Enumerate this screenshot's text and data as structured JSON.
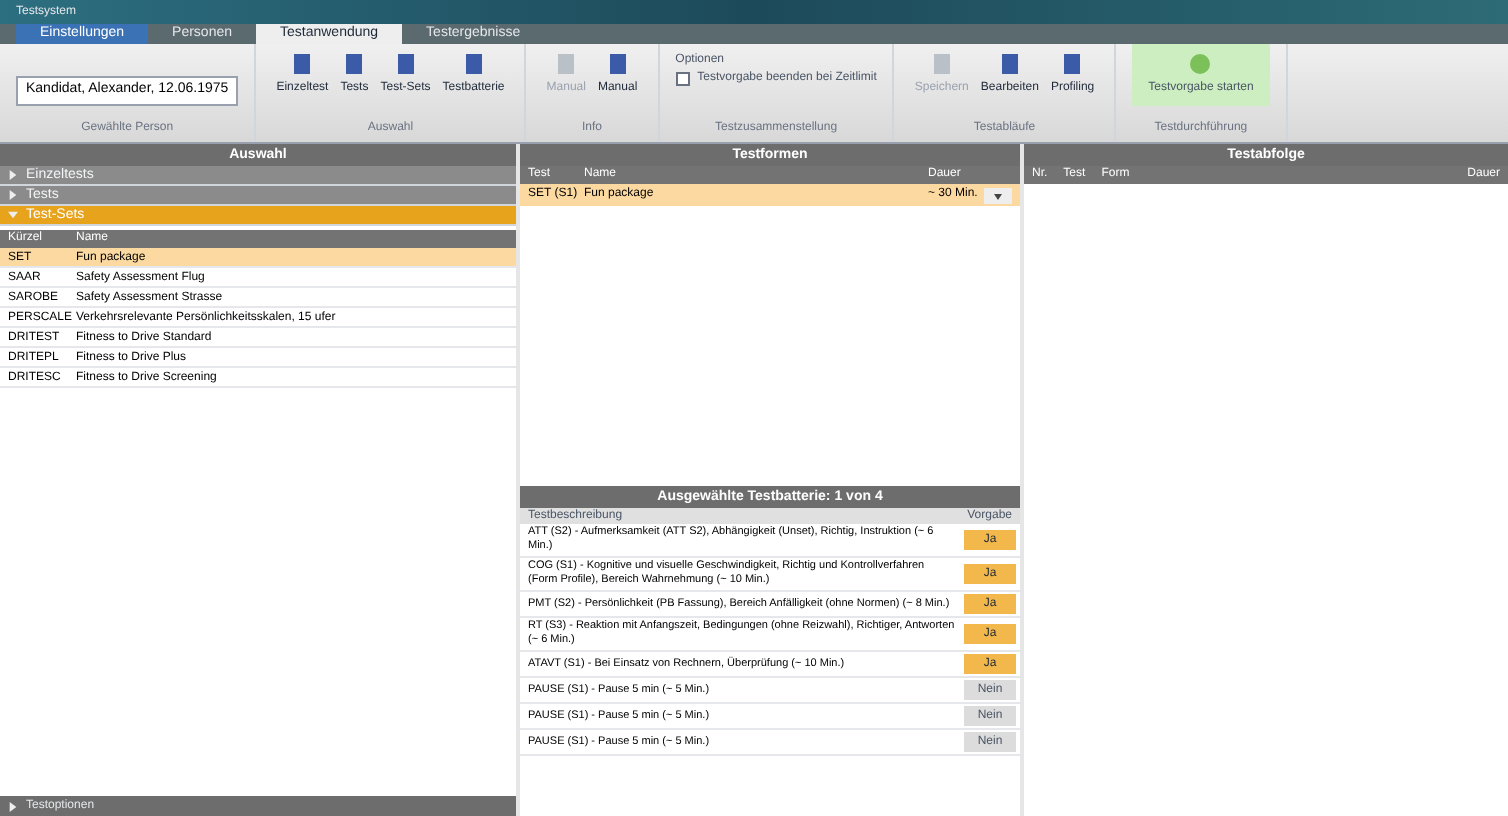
{
  "window": {
    "title": "Testsystem"
  },
  "tabs": [
    {
      "label": "Einstellungen",
      "selected": false
    },
    {
      "label": "Personen",
      "selected": false
    },
    {
      "label": "Testanwendung",
      "selected": true
    },
    {
      "label": "Testergebnisse",
      "selected": false
    }
  ],
  "ribbon": {
    "groups": [
      {
        "kind": "field",
        "caption": "Gewählte Person",
        "value": "Kandidat, Alexander, 12.06.1975"
      },
      {
        "kind": "buttons",
        "caption": "Auswahl",
        "buttons": [
          {
            "label": "Einzeltest",
            "disabled": false
          },
          {
            "label": "Tests",
            "disabled": false
          },
          {
            "label": "Test-Sets",
            "disabled": false
          },
          {
            "label": "Testbatterie",
            "disabled": false
          }
        ]
      },
      {
        "kind": "buttons",
        "caption": "Info",
        "buttons": [
          {
            "label": "Manual",
            "disabled": true
          },
          {
            "label": "Manual",
            "disabled": false
          }
        ]
      },
      {
        "kind": "checkbox",
        "caption": "Testzusammenstellung",
        "heading": "Optionen",
        "label": "Testvorgabe beenden bei Zeitlimit",
        "checked": false
      },
      {
        "kind": "buttons",
        "caption": "Testabläufe",
        "buttons": [
          {
            "label": "Speichern",
            "disabled": true
          },
          {
            "label": "Bearbeiten",
            "disabled": false
          },
          {
            "label": "Profiling",
            "disabled": false
          }
        ]
      },
      {
        "kind": "start",
        "caption": "Testdurchführung",
        "label": "Testvorgabe starten"
      }
    ]
  },
  "left": {
    "title": "Auswahl",
    "sections": [
      {
        "label": "Einzeltests",
        "expanded": false
      },
      {
        "label": "Tests",
        "expanded": false
      },
      {
        "label": "Test-Sets",
        "expanded": true
      }
    ],
    "columns": [
      "Kürzel",
      "Name"
    ],
    "rows": [
      {
        "code": "SET",
        "name": "Fun package",
        "selected": true
      },
      {
        "code": "SAAR",
        "name": "Safety Assessment Flug",
        "selected": false
      },
      {
        "code": "SAROBE",
        "name": "Safety Assessment Strasse",
        "selected": false
      },
      {
        "code": "PERSCALE",
        "name": "Verkehrsrelevante Persönlichkeitsskalen, 15 ufer",
        "selected": false
      },
      {
        "code": "DRITEST",
        "name": "Fitness to Drive Standard",
        "selected": false
      },
      {
        "code": "DRITEPL",
        "name": "Fitness to Drive Plus",
        "selected": false
      },
      {
        "code": "DRITESC",
        "name": "Fitness to Drive Screening",
        "selected": false
      }
    ],
    "footer": "Testoptionen"
  },
  "middle": {
    "title": "Testformen",
    "columns": [
      "Test",
      "Name",
      "Dauer"
    ],
    "rows": [
      {
        "code": "SET (S1)",
        "name": "Fun package",
        "duration": "~ 30 Min.",
        "selected": true
      }
    ],
    "battery": {
      "title": "Ausgewählte Testbatterie: 1 von 4",
      "columns": [
        "Testbeschreibung",
        "Vorgabe"
      ],
      "rows": [
        {
          "text": "ATT (S2) - Aufmerksamkeit (ATT S2), Abhängigkeit (Unset), Richtig, Instruktion (~ 6 Min.)",
          "vorgabe": "Ja",
          "on": true
        },
        {
          "text": "COG (S1) - Kognitive und visuelle Geschwindigkeit, Richtig und Kontrollverfahren (Form Profile), Bereich Wahrnehmung (~ 10 Min.)",
          "vorgabe": "Ja",
          "on": true
        },
        {
          "text": "PMT (S2) - Persönlichkeit (PB Fassung), Bereich Anfälligkeit (ohne Normen) (~ 8 Min.)",
          "vorgabe": "Ja",
          "on": true
        },
        {
          "text": "RT (S3) - Reaktion mit Anfangszeit, Bedingungen (ohne Reizwahl), Richtiger, Antworten (~ 6 Min.)",
          "vorgabe": "Ja",
          "on": true
        },
        {
          "text": "ATAVT (S1) - Bei Einsatz von Rechnern, Überprüfung (~ 10 Min.)",
          "vorgabe": "Ja",
          "on": true
        },
        {
          "text": "PAUSE (S1) - Pause 5 min (~ 5 Min.)",
          "vorgabe": "Nein",
          "on": false
        },
        {
          "text": "PAUSE (S1) - Pause 5 min (~ 5 Min.)",
          "vorgabe": "Nein",
          "on": false
        },
        {
          "text": "PAUSE (S1) - Pause 5 min (~ 5 Min.)",
          "vorgabe": "Nein",
          "on": false
        }
      ]
    }
  },
  "right": {
    "title": "Testabfolge",
    "columns": [
      "Nr.",
      "Test",
      "Form",
      "Dauer"
    ]
  }
}
